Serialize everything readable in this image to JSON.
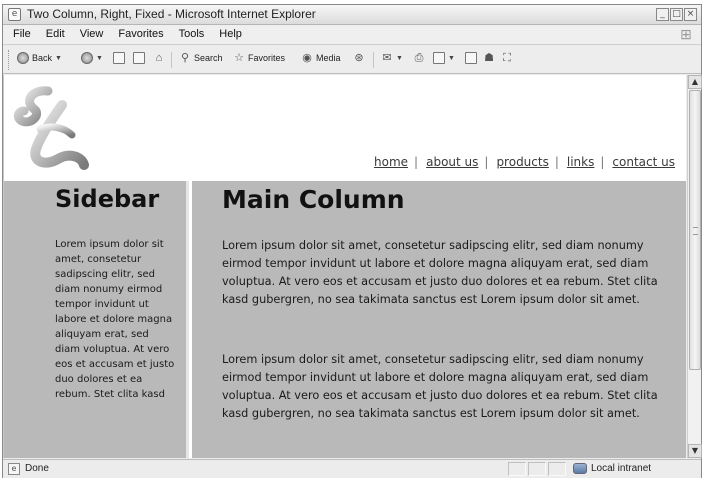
{
  "window": {
    "title": "Two Column, Right, Fixed - Microsoft Internet Explorer"
  },
  "menu": [
    "File",
    "Edit",
    "View",
    "Favorites",
    "Tools",
    "Help"
  ],
  "toolbar": {
    "back_label": "Back",
    "search_label": "Search",
    "favorites_label": "Favorites",
    "media_label": "Media"
  },
  "page": {
    "nav": [
      "home",
      "about us",
      "products",
      "links",
      "contact us"
    ],
    "sidebar": {
      "heading": "Sidebar",
      "text": "Lorem ipsum dolor sit amet, consetetur sadipscing elitr, sed diam nonumy eirmod tempor invidunt ut labore et dolore magna aliquyam erat, sed diam voluptua. At vero eos et accusam et justo duo dolores et ea rebum. Stet clita kasd"
    },
    "main": {
      "heading": "Main Column",
      "paragraphs": [
        "Lorem ipsum dolor sit amet, consetetur sadipscing elitr, sed diam nonumy eirmod tempor invidunt ut labore et dolore magna aliquyam erat, sed diam voluptua. At vero eos et accusam et justo duo dolores et ea rebum. Stet clita kasd gubergren, no sea takimata sanctus est Lorem ipsum dolor sit amet.",
        "Lorem ipsum dolor sit amet, consetetur sadipscing elitr, sed diam nonumy eirmod tempor invidunt ut labore et dolore magna aliquyam erat, sed diam voluptua. At vero eos et accusam et justo duo dolores et ea rebum. Stet clita kasd gubergren, no sea takimata sanctus est Lorem ipsum dolor sit amet."
      ]
    }
  },
  "status": {
    "text": "Done",
    "zone": "Local intranet"
  },
  "colors": {
    "content_gray": "#b9b9b9",
    "window_chrome": "#ececec"
  }
}
